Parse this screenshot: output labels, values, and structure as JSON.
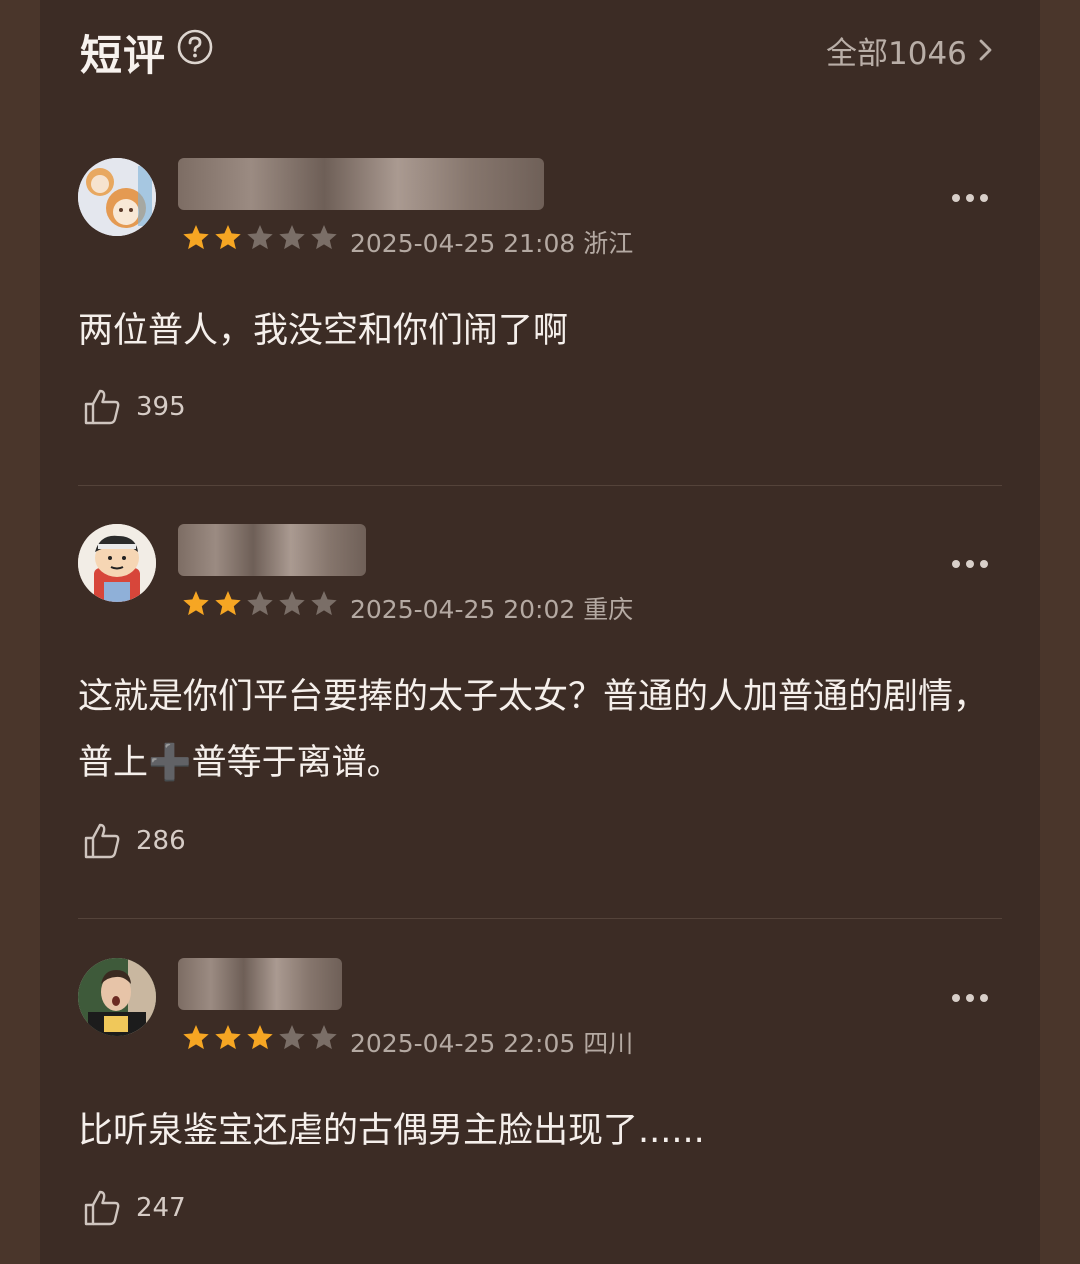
{
  "header": {
    "title": "短评",
    "help_icon": "question-circle-icon",
    "all_label": "全部1046",
    "chevron_icon": "chevron-right-icon"
  },
  "colors": {
    "background": "#3c2c25",
    "star_filled": "#f6a623",
    "star_empty": "#7a6e67",
    "text_primary": "#f5efeb",
    "text_secondary": "#b4a9a2"
  },
  "reviews": [
    {
      "username": "",
      "rating": 2,
      "max_rating": 5,
      "datetime": "2025-04-25 21:08",
      "region": "浙江",
      "meta": "2025-04-25 21:08 浙江",
      "content": "两位普人，我没空和你们闹了啊",
      "likes": "395"
    },
    {
      "username": "",
      "rating": 2,
      "max_rating": 5,
      "datetime": "2025-04-25 20:02",
      "region": "重庆",
      "meta": "2025-04-25 20:02 重庆",
      "content": "这就是你们平台要捧的太子太女？普通的人加普通的剧情，普上➕普等于离谱。",
      "likes": "286"
    },
    {
      "username": "",
      "rating": 3,
      "max_rating": 5,
      "datetime": "2025-04-25 22:05",
      "region": "四川",
      "meta": "2025-04-25 22:05 四川",
      "content": "比听泉鉴宝还虐的古偶男主脸出现了......",
      "likes": "247"
    }
  ]
}
